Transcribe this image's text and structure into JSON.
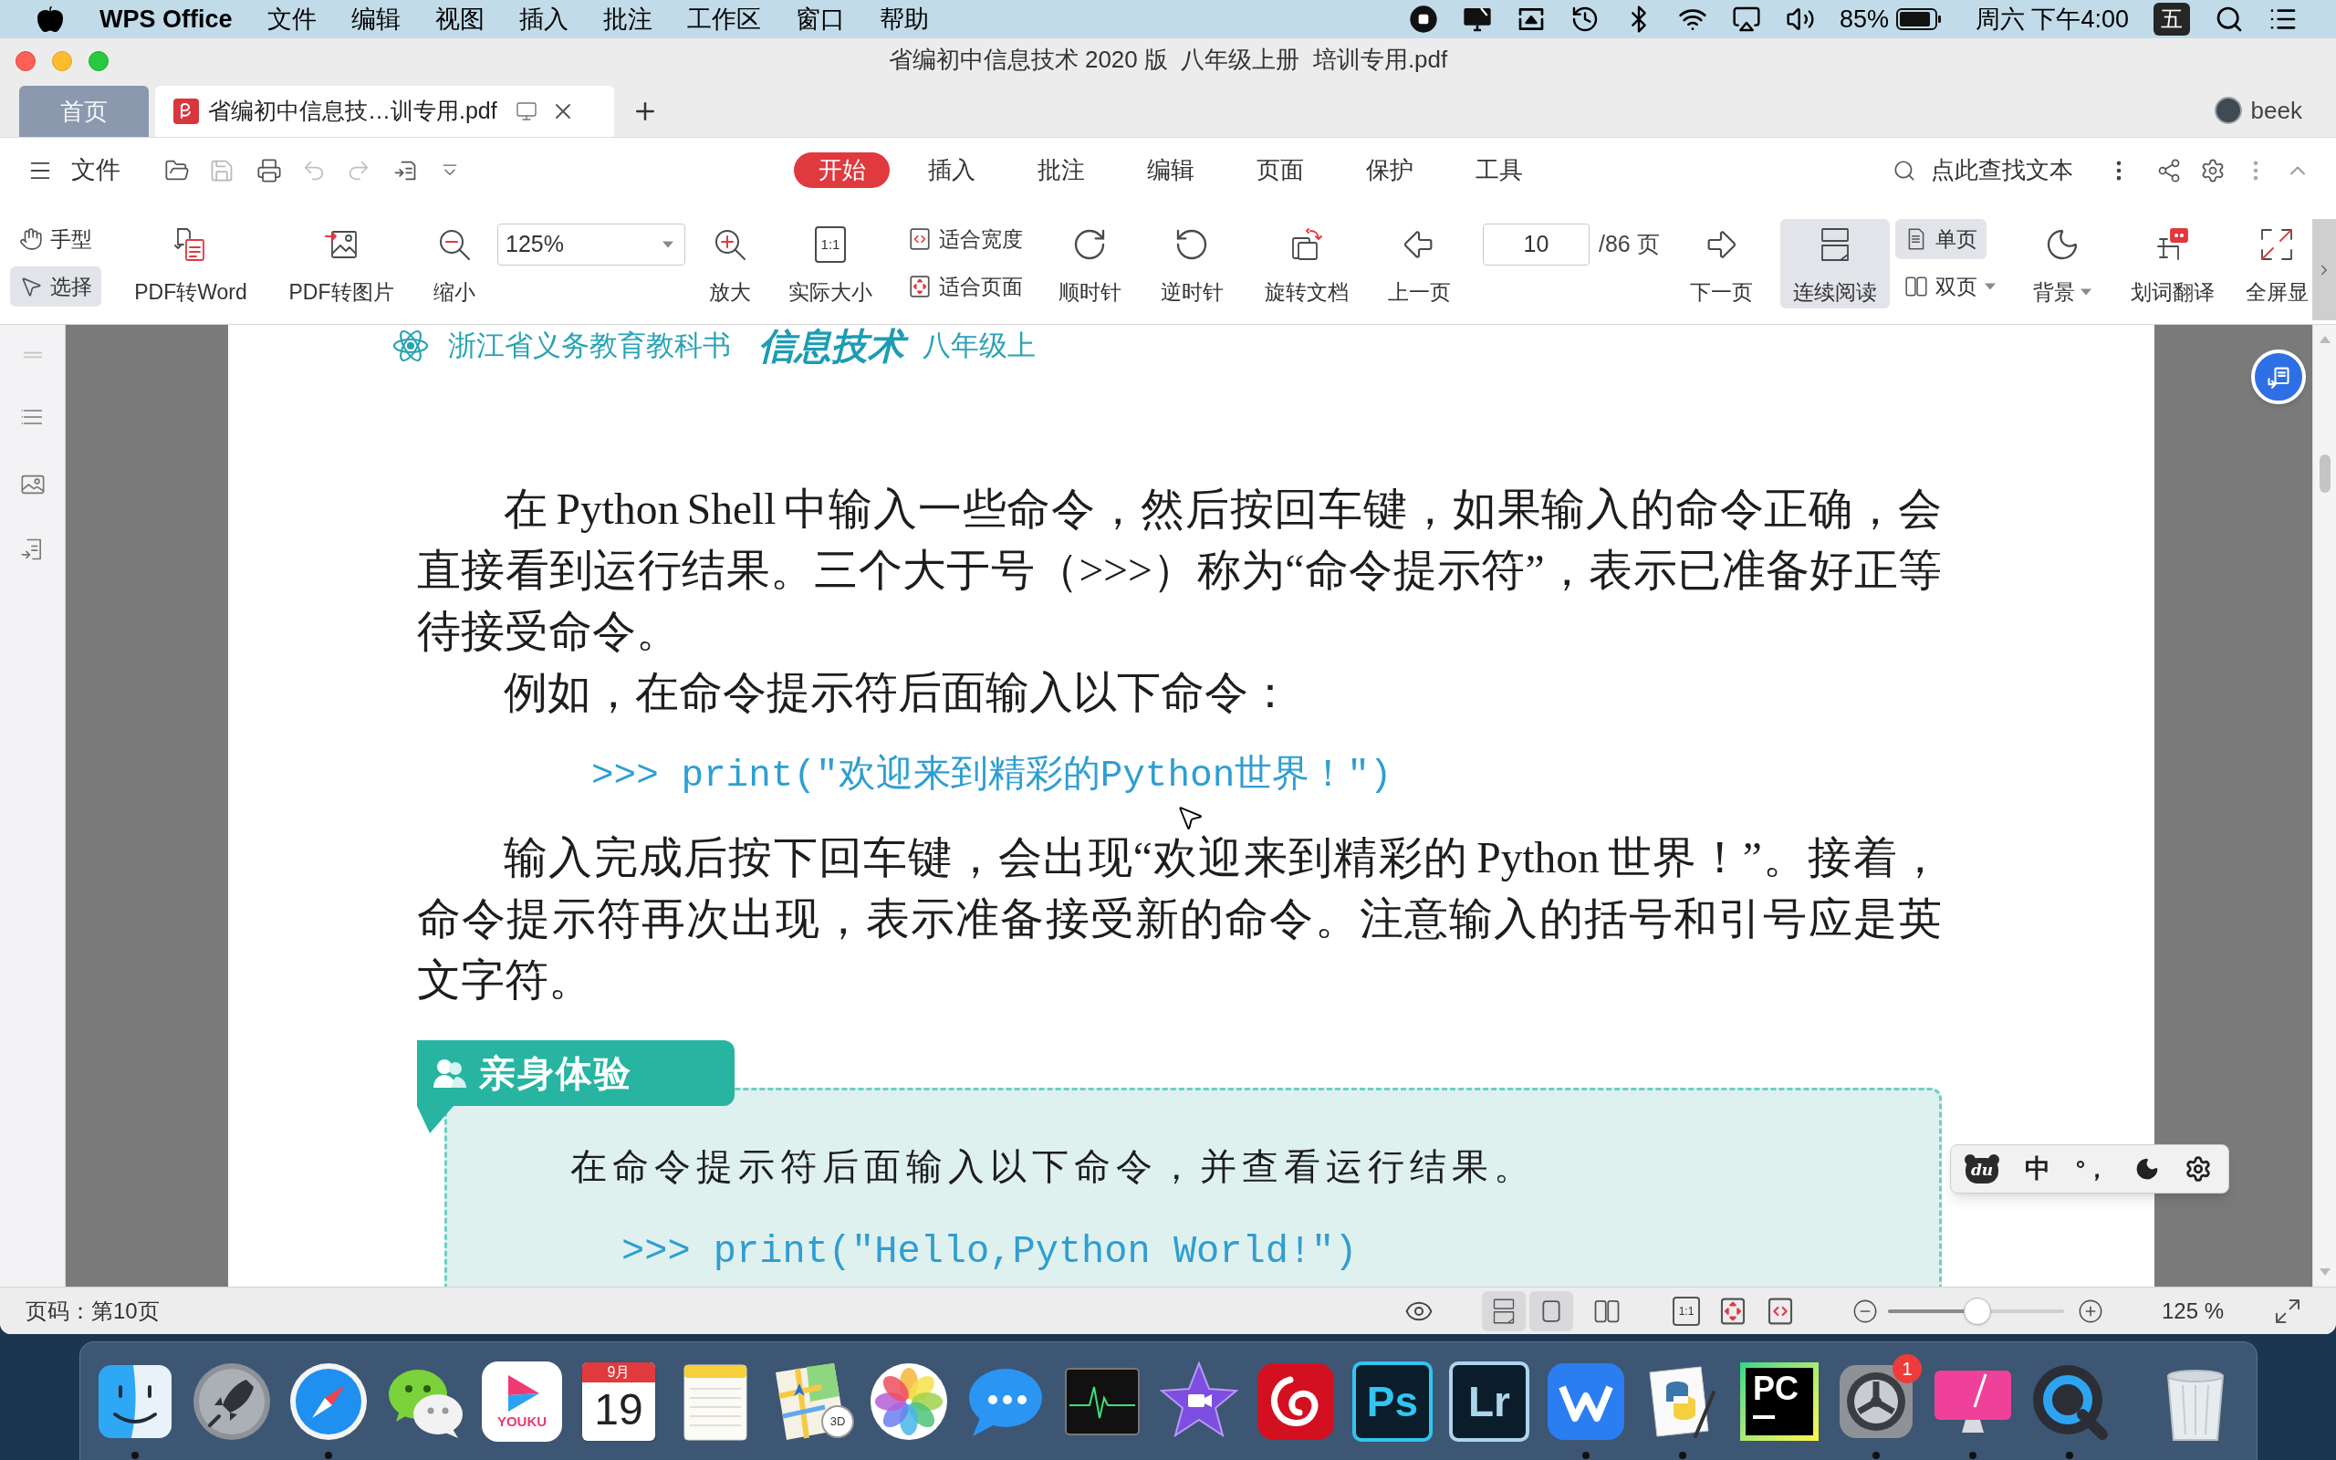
{
  "menu_bar": {
    "app_name": "WPS Office",
    "menus": [
      "文件",
      "编辑",
      "视图",
      "插入",
      "批注",
      "工作区",
      "窗口",
      "帮助"
    ],
    "battery": "85%",
    "clock": "周六 下午4:00",
    "input_method": "五"
  },
  "window": {
    "title": "省编初中信息技术 2020 版  八年级上册  培训专用.pdf"
  },
  "tabs": [
    {
      "kind": "home",
      "label": "首页",
      "selected": false
    },
    {
      "kind": "document",
      "label": "省编初中信息技…训专用.pdf",
      "selected": true
    }
  ],
  "account": {
    "name": "beek"
  },
  "ribbon": {
    "file_menu": "文件",
    "tabs": [
      {
        "label": "开始",
        "selected": true
      },
      {
        "label": "插入",
        "selected": false
      },
      {
        "label": "批注",
        "selected": false
      },
      {
        "label": "编辑",
        "selected": false
      },
      {
        "label": "页面",
        "selected": false
      },
      {
        "label": "保护",
        "selected": false
      },
      {
        "label": "工具",
        "selected": false
      }
    ],
    "search": {
      "placeholder": "点此查找文本"
    }
  },
  "toolbar": {
    "items": [
      {
        "kind": "pair",
        "options": [
          {
            "label": "手型",
            "selected": false
          },
          {
            "label": "选择",
            "selected": true
          }
        ]
      },
      {
        "kind": "large",
        "label": "PDF转Word"
      },
      {
        "kind": "large",
        "label": "PDF转图片"
      },
      {
        "kind": "large",
        "label": "缩小"
      },
      {
        "kind": "combo",
        "value": "125%"
      },
      {
        "kind": "large",
        "label": "放大"
      },
      {
        "kind": "large",
        "label": "实际大小",
        "glyph": "1:1"
      },
      {
        "kind": "pair",
        "options": [
          {
            "label": "适合宽度"
          },
          {
            "label": "适合页面"
          }
        ]
      },
      {
        "kind": "large",
        "label": "顺时针"
      },
      {
        "kind": "large",
        "label": "逆时针"
      },
      {
        "kind": "large",
        "label": "旋转文档"
      },
      {
        "kind": "large",
        "label": "上一页"
      },
      {
        "kind": "page",
        "value": "10",
        "total": "/86 页"
      },
      {
        "kind": "large",
        "label": "下一页"
      },
      {
        "kind": "large",
        "label": "连续阅读",
        "selected": true
      },
      {
        "kind": "pair",
        "options": [
          {
            "label": "单页",
            "selected": true
          },
          {
            "label": "双页",
            "selected": false,
            "dropdown": true
          }
        ]
      },
      {
        "kind": "large",
        "label": "背景",
        "dropdown": true
      },
      {
        "kind": "large",
        "label": "划词翻译"
      },
      {
        "kind": "large",
        "label": "全屏显"
      }
    ]
  },
  "document": {
    "header": {
      "series": "浙江省义务教育教科书",
      "subject": "信息技术",
      "grade": "八年级上"
    },
    "blocks": [
      {
        "kind": "paragraph",
        "text": "在 Python Shell 中输入一些命令，然后按回车键，如果输入的命令正确，会直接看到运行结果。三个大于号（>>>）称为“命令提示符”，表示已准备好正等待接受命令。"
      },
      {
        "kind": "paragraph",
        "text": "例如，在命令提示符后面输入以下命令："
      },
      {
        "kind": "code",
        "text": ">>> print(\"欢迎来到精彩的Python世界！\")"
      },
      {
        "kind": "paragraph",
        "text": "输入完成后按下回车键，会出现“欢迎来到精彩的 Python 世界！”。接着，命令提示符再次出现，表示准备接受新的命令。注意输入的括号和引号应是英文字符。"
      },
      {
        "kind": "activity",
        "title": "亲身体验",
        "instruction": "在命令提示符后面输入以下命令，并查看运行结果。",
        "code": ">>> print(\"Hello,Python World!\")"
      }
    ]
  },
  "ime_toolbar": {
    "logo": "du",
    "mode": "中",
    "punctuation": "°，"
  },
  "status_bar": {
    "page": "页码：第10页",
    "view_modes": [
      {
        "selected": true
      },
      {
        "selected": true
      },
      {
        "selected": false
      }
    ],
    "actual_size": "1:1",
    "zoom": {
      "level": 0.51,
      "reading": "125 %"
    }
  },
  "dock": {
    "apps": [
      {
        "kind": "face",
        "running": true
      },
      {
        "kind": "rocket",
        "running": false
      },
      {
        "kind": "compass",
        "running": true
      },
      {
        "kind": "chat",
        "running": false
      },
      {
        "kind": "play",
        "label": "YOUKU",
        "running": false
      },
      {
        "kind": "calendar",
        "month": "9月",
        "day": "19",
        "running": false
      },
      {
        "kind": "notepad",
        "running": false
      },
      {
        "kind": "map",
        "label": "3D",
        "running": false
      },
      {
        "kind": "flower",
        "running": false
      },
      {
        "kind": "bubble",
        "running": false
      },
      {
        "kind": "pulse",
        "running": false
      },
      {
        "kind": "star",
        "running": false
      },
      {
        "kind": "swirl",
        "running": false
      },
      {
        "kind": "letters",
        "label": "Ps",
        "color": "#31c5f0",
        "running": false
      },
      {
        "kind": "letters",
        "label": "Lr",
        "color": "#add5ec",
        "running": false
      },
      {
        "kind": "zigzag",
        "running": true
      },
      {
        "kind": "snake",
        "running": true
      },
      {
        "kind": "framed",
        "label": "PC",
        "running": false
      },
      {
        "kind": "gear",
        "badge": "1",
        "running": true
      },
      {
        "kind": "monitor",
        "running": true
      },
      {
        "kind": "magnifier",
        "running": true
      }
    ]
  }
}
